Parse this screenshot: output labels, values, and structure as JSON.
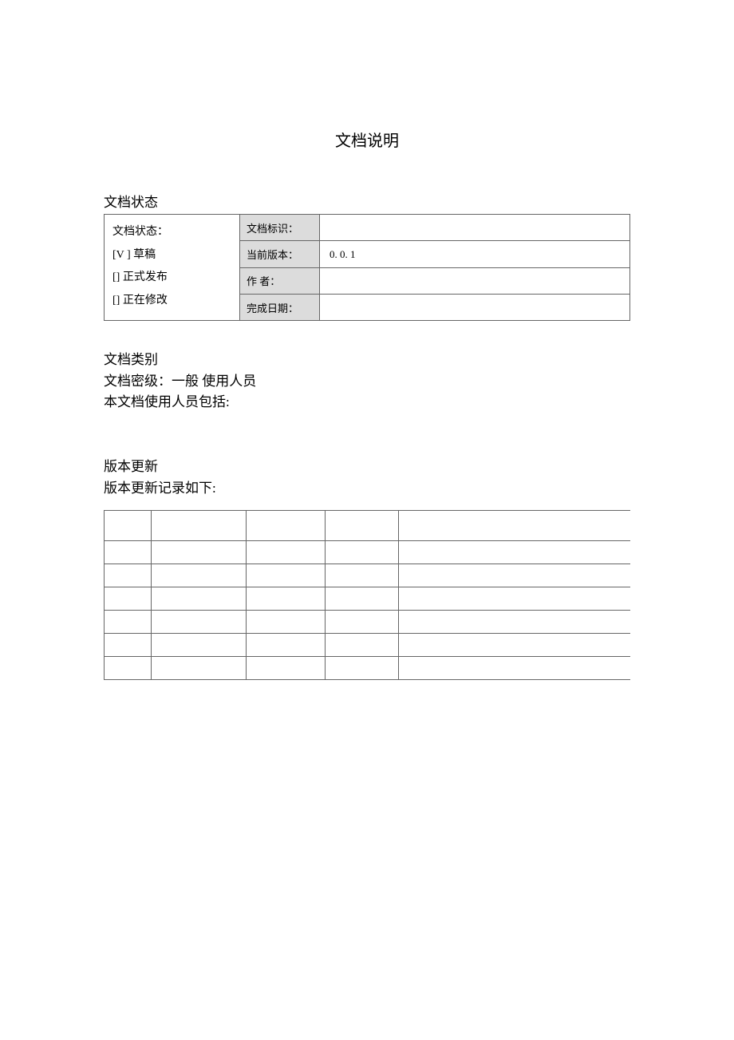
{
  "title": "文档说明",
  "sections": {
    "status": {
      "heading": "文档状态",
      "leftCell": {
        "line1": "文档状态：",
        "option1": "[V  ] 草稿",
        "option2": "[]    正式发布",
        "option3": "[]    正在修改"
      },
      "rows": {
        "docId": {
          "label": "文档标识：",
          "value": ""
        },
        "version": {
          "label": "当前版本：",
          "value": "0. 0. 1"
        },
        "author": {
          "label": "作      者：",
          "value": ""
        },
        "completeDate": {
          "label": "完成日期：",
          "value": ""
        }
      }
    },
    "category": {
      "heading": "文档类别",
      "line1": "文档密级：一般  使用人员",
      "line2": "本文档使用人员包括:"
    },
    "versionUpdate": {
      "heading": "版本更新",
      "line1": "版本更新记录如下:",
      "rows": [
        [
          "",
          "",
          "",
          "",
          ""
        ],
        [
          "",
          "",
          "",
          "",
          ""
        ],
        [
          "",
          "",
          "",
          "",
          ""
        ],
        [
          "",
          "",
          "",
          "",
          ""
        ],
        [
          "",
          "",
          "",
          "",
          ""
        ],
        [
          "",
          "",
          "",
          "",
          ""
        ],
        [
          "",
          "",
          "",
          "",
          ""
        ]
      ]
    }
  }
}
